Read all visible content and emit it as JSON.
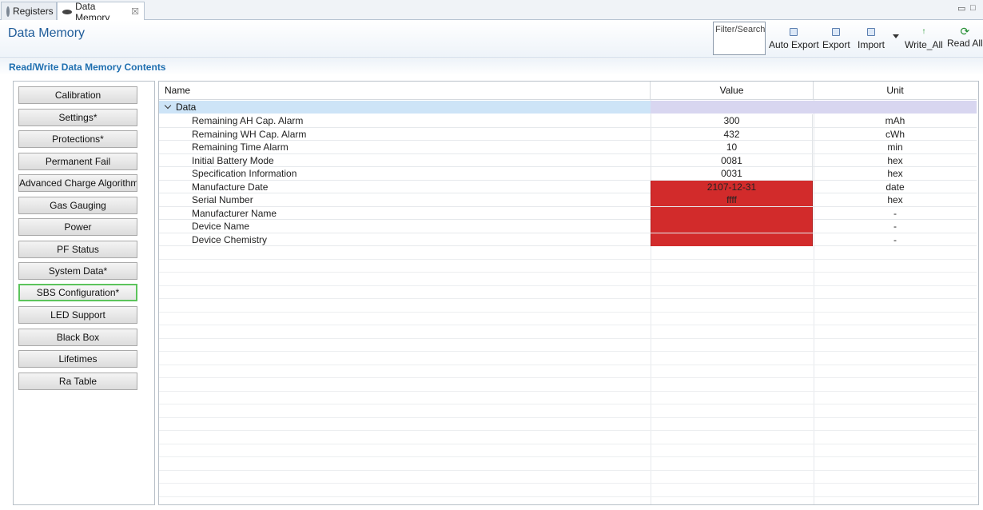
{
  "tabs": [
    {
      "label": "Registers",
      "icon": "gear-icon"
    },
    {
      "label": "Data Memory",
      "icon": "chip-icon",
      "close": "☒"
    }
  ],
  "window_controls": {
    "minimize": "▭",
    "maximize": "□"
  },
  "header": {
    "title": "Data Memory",
    "filter_placeholder": "Filter/Search",
    "buttons": {
      "auto_export": "Auto Export",
      "export": "Export",
      "import": "Import",
      "write_all": "Write_All",
      "read_all": "Read All"
    }
  },
  "section": {
    "title": "Read/Write Data Memory Contents"
  },
  "categories": [
    "Calibration",
    "Settings*",
    "Protections*",
    "Permanent Fail",
    "Advanced Charge Algorithm*",
    "Gas Gauging",
    "Power",
    "PF Status",
    "System Data*",
    "SBS Configuration*",
    "LED Support",
    "Black Box",
    "Lifetimes",
    "Ra Table"
  ],
  "active_category": "SBS Configuration*",
  "table": {
    "columns": [
      "Name",
      "Value",
      "Unit"
    ],
    "group": "Data",
    "rows": [
      {
        "name": "Remaining AH Cap. Alarm",
        "value": "300",
        "unit": "mAh",
        "error": false
      },
      {
        "name": "Remaining WH Cap. Alarm",
        "value": "432",
        "unit": "cWh",
        "error": false
      },
      {
        "name": "Remaining Time Alarm",
        "value": "10",
        "unit": "min",
        "error": false
      },
      {
        "name": "Initial Battery Mode",
        "value": "0081",
        "unit": "hex",
        "error": false
      },
      {
        "name": "Specification Information",
        "value": "0031",
        "unit": "hex",
        "error": false
      },
      {
        "name": "Manufacture Date",
        "value": "2107-12-31",
        "unit": "date",
        "error": true
      },
      {
        "name": "Serial Number",
        "value": "ffff",
        "unit": "hex",
        "error": true
      },
      {
        "name": "Manufacturer Name",
        "value": "",
        "unit": "-",
        "error": true
      },
      {
        "name": "Device Name",
        "value": "",
        "unit": "-",
        "error": true
      },
      {
        "name": "Device Chemistry",
        "value": "",
        "unit": "-",
        "error": true
      }
    ]
  },
  "colors": {
    "error_cell": "#d22b2b",
    "group_row": "#cde4f7",
    "active_border": "#5cc45c",
    "title_blue": "#1f5c99"
  }
}
